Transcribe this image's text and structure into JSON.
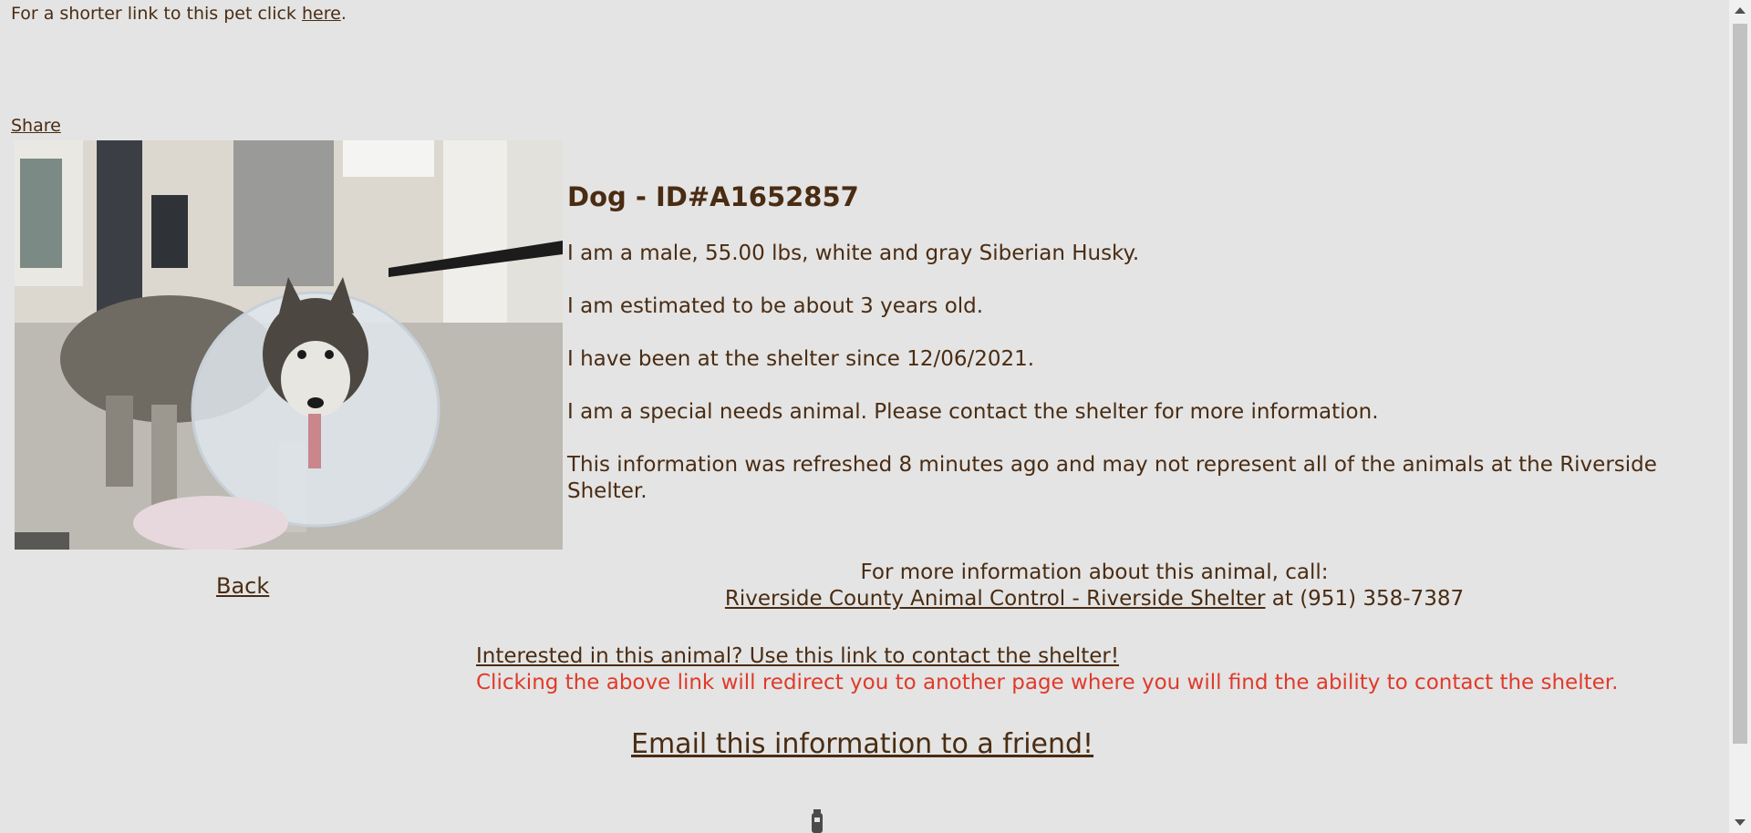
{
  "short_link": {
    "prefix": "For a shorter link to this pet click ",
    "link_label": "here",
    "suffix": "."
  },
  "share_label": "Share",
  "animal": {
    "heading": "Dog - ID#A1652857",
    "description": "I am a male, 55.00 lbs, white and gray Siberian Husky.",
    "age": "I am estimated to be about 3 years old.",
    "since": "I have been at the shelter since 12/06/2021.",
    "special_needs": "I am a special needs animal. Please contact the shelter for more information.",
    "refresh_note": "This information was refreshed 8 minutes ago and may not represent all of the animals at the Riverside Shelter."
  },
  "back_label": "Back",
  "more_info": {
    "line1": "For more information about this animal, call:",
    "shelter_link": "Riverside County Animal Control - Riverside Shelter",
    "phone_text": " at (951) 358-7387"
  },
  "contact": {
    "link_label": "Interested in this animal? Use this link to contact the shelter!",
    "note": "Clicking the above link will redirect you to another page where you will find the ability to contact the shelter.",
    "note_color": "#e03a2a"
  },
  "email_label": "Email this information to a friend!"
}
